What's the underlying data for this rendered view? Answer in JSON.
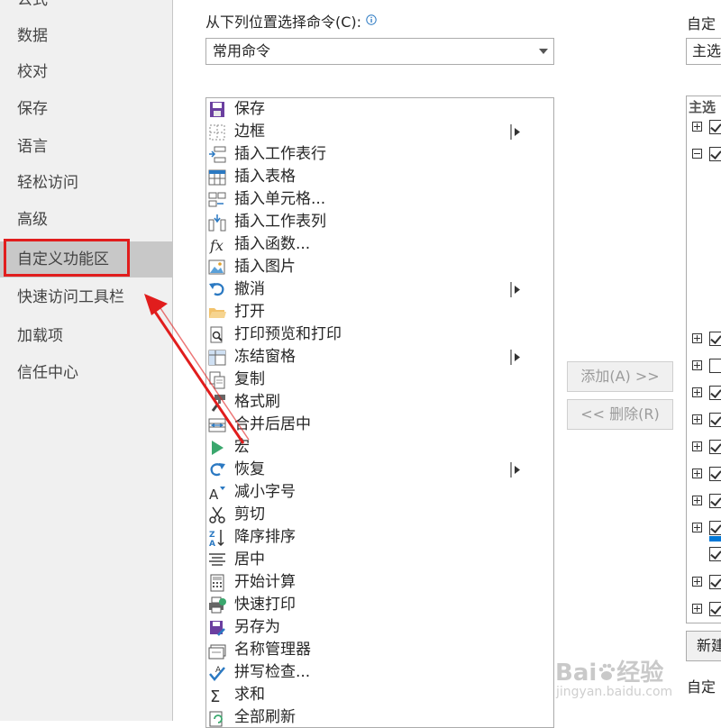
{
  "sidebar": {
    "items": [
      {
        "label": "公式"
      },
      {
        "label": "数据"
      },
      {
        "label": "校对"
      },
      {
        "label": "保存"
      },
      {
        "label": "语言"
      },
      {
        "label": "轻松访问"
      },
      {
        "label": "高级"
      },
      {
        "label": "自定义功能区",
        "selected": true
      },
      {
        "label": "快速访问工具栏"
      },
      {
        "label": "加载项"
      },
      {
        "label": "信任中心"
      }
    ]
  },
  "commands": {
    "source_label": "从下列位置选择命令(C):",
    "source_info_icon": "info-icon",
    "source_value": "常用命令",
    "items": [
      {
        "label": "保存",
        "icon": "save-icon",
        "submenu": false
      },
      {
        "label": "边框",
        "icon": "border-icon",
        "submenu": true
      },
      {
        "label": "插入工作表行",
        "icon": "insert-sheet-rows-icon",
        "submenu": false
      },
      {
        "label": "插入表格",
        "icon": "insert-table-icon",
        "submenu": false
      },
      {
        "label": "插入单元格...",
        "icon": "insert-cells-icon",
        "submenu": false
      },
      {
        "label": "插入工作表列",
        "icon": "insert-sheet-columns-icon",
        "submenu": false
      },
      {
        "label": "插入函数...",
        "icon": "insert-function-icon",
        "submenu": false
      },
      {
        "label": "插入图片",
        "icon": "insert-picture-icon",
        "submenu": false
      },
      {
        "label": "撤消",
        "icon": "undo-icon",
        "submenu": true
      },
      {
        "label": "打开",
        "icon": "open-folder-icon",
        "submenu": false
      },
      {
        "label": "打印预览和打印",
        "icon": "print-preview-icon",
        "submenu": false
      },
      {
        "label": "冻结窗格",
        "icon": "freeze-panes-icon",
        "submenu": true
      },
      {
        "label": "复制",
        "icon": "copy-icon",
        "submenu": false
      },
      {
        "label": "格式刷",
        "icon": "format-painter-icon",
        "submenu": false
      },
      {
        "label": "合并后居中",
        "icon": "merge-center-icon",
        "submenu": false
      },
      {
        "label": "宏",
        "icon": "macro-icon",
        "submenu": false
      },
      {
        "label": "恢复",
        "icon": "redo-icon",
        "submenu": true
      },
      {
        "label": "减小字号",
        "icon": "decrease-font-icon",
        "submenu": false
      },
      {
        "label": "剪切",
        "icon": "scissors-icon",
        "submenu": false
      },
      {
        "label": "降序排序",
        "icon": "sort-descending-icon",
        "submenu": false
      },
      {
        "label": "居中",
        "icon": "align-center-icon",
        "submenu": false
      },
      {
        "label": "开始计算",
        "icon": "calculator-icon",
        "submenu": false
      },
      {
        "label": "快速打印",
        "icon": "quick-print-icon",
        "submenu": false
      },
      {
        "label": "另存为",
        "icon": "save-as-icon",
        "submenu": false
      },
      {
        "label": "名称管理器",
        "icon": "name-manager-icon",
        "submenu": false
      },
      {
        "label": "拼写检查...",
        "icon": "spell-check-icon",
        "submenu": false
      },
      {
        "label": "求和",
        "icon": "sum-icon",
        "submenu": false
      },
      {
        "label": "全部刷新",
        "icon": "refresh-all-icon",
        "submenu": false
      }
    ]
  },
  "buttons": {
    "add": "添加(A) >>",
    "remove": "<< 删除(R)"
  },
  "ribbon": {
    "label": "自定",
    "dropdown_value": "主选",
    "tree_header": "主选",
    "new_button": "新建",
    "bottom_label": "自定"
  },
  "watermark": {
    "brand": "Bai",
    "brand2": "经验",
    "url": "jingyan.baidu.com"
  },
  "colors": {
    "highlight": "#e11d1d",
    "sidebar_bg": "#f0f0f0",
    "sidebar_selected": "#c8c8c8",
    "tree_selection": "#0078d7"
  }
}
